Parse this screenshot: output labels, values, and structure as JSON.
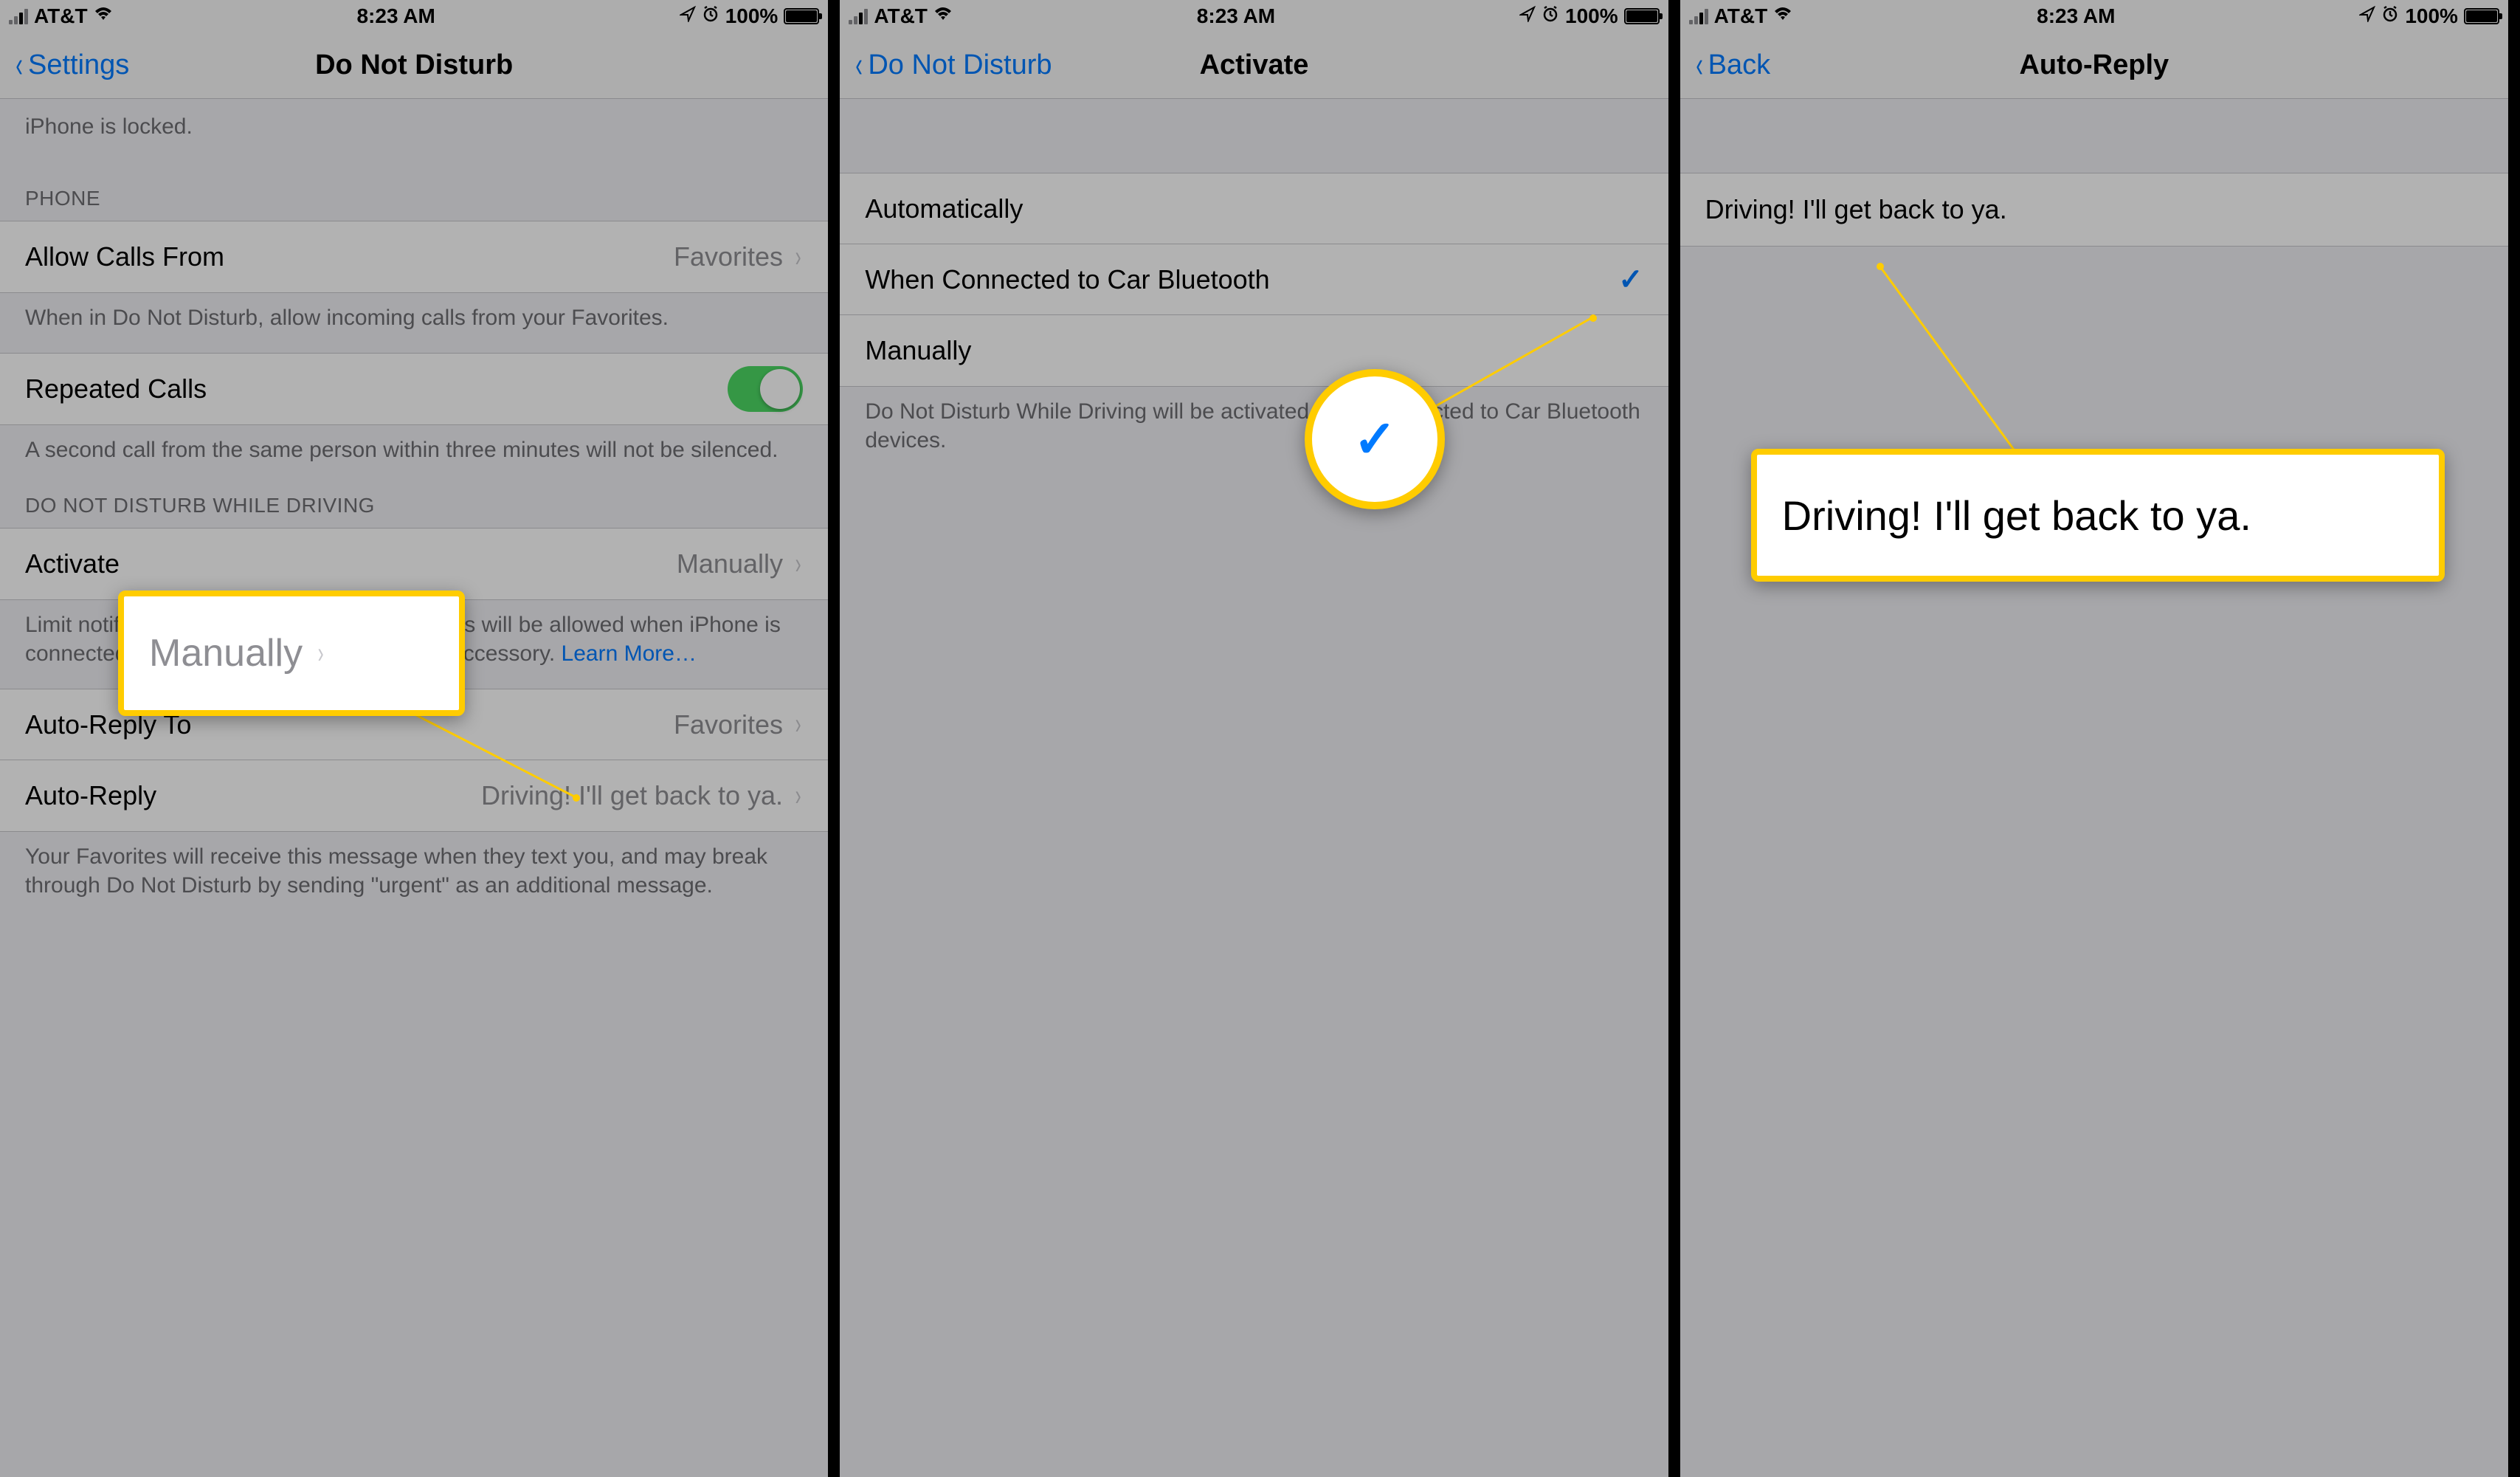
{
  "status": {
    "carrier": "AT&T",
    "time": "8:23 AM",
    "battery": "100%"
  },
  "phone1": {
    "back": "Settings",
    "title": "Do Not Disturb",
    "locked_footer": "iPhone is locked.",
    "section_phone": "PHONE",
    "allow_calls": {
      "label": "Allow Calls From",
      "value": "Favorites"
    },
    "allow_calls_footer": "When in Do Not Disturb, allow incoming calls from your Favorites.",
    "repeated": {
      "label": "Repeated Calls"
    },
    "repeated_footer": "A second call from the same person within three minutes will not be silenced.",
    "section_driving": "DO NOT DISTURB WHILE DRIVING",
    "activate": {
      "label": "Activate",
      "value": "Manually"
    },
    "activate_footer_1": "Limit notifications while driving. Incoming calls will be allowed when iPhone is connected to car Bluetooth or a hands-free accessory. ",
    "activate_footer_link": "Learn More…",
    "autoreply_to": {
      "label": "Auto-Reply To",
      "value": "Favorites"
    },
    "autoreply": {
      "label": "Auto-Reply",
      "value": "Driving! I'll get back to ya."
    },
    "autoreply_footer": "Your Favorites will receive this message when they text you, and may break through Do Not Disturb by sending \"urgent\" as an additional message.",
    "callout_label": "Manually"
  },
  "phone2": {
    "back": "Do Not Disturb",
    "title": "Activate",
    "opt1": "Automatically",
    "opt2": "When Connected to Car Bluetooth",
    "opt3": "Manually",
    "footer": "Do Not Disturb While Driving will be activated while connected to Car Bluetooth devices."
  },
  "phone3": {
    "back": "Back",
    "title": "Auto-Reply",
    "message": "Driving! I'll get back to ya.",
    "callout_label": "Driving! I'll get back to ya."
  }
}
